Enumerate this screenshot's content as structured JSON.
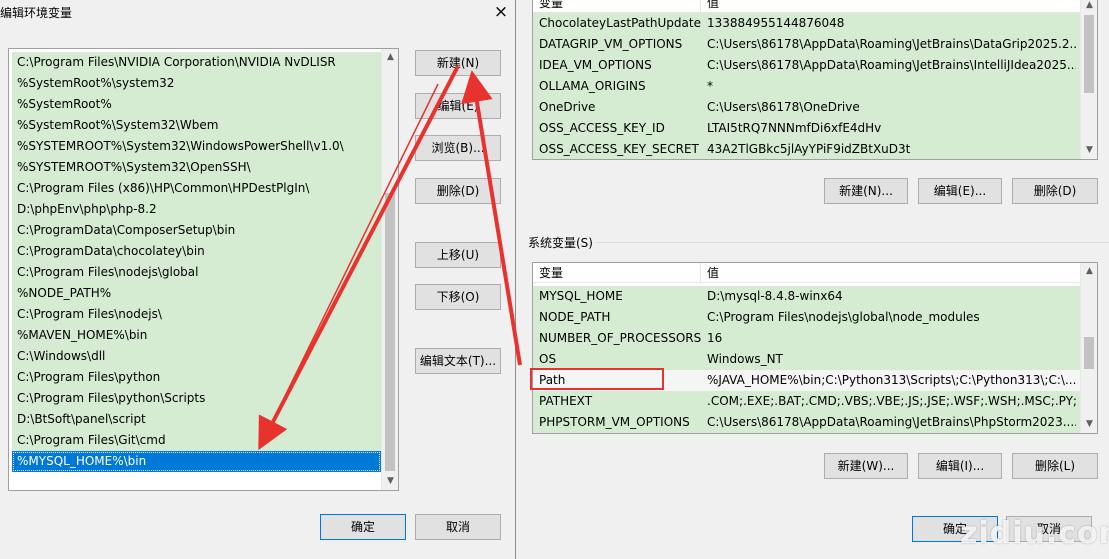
{
  "dialog": {
    "title": "编辑环境变量",
    "close_glyph": "×",
    "path_items": [
      "C:\\Program Files\\NVIDIA Corporation\\NVIDIA NvDLISR",
      "%SystemRoot%\\system32",
      "%SystemRoot%",
      "%SystemRoot%\\System32\\Wbem",
      "%SYSTEMROOT%\\System32\\WindowsPowerShell\\v1.0\\",
      "%SYSTEMROOT%\\System32\\OpenSSH\\",
      "C:\\Program Files (x86)\\HP\\Common\\HPDestPlgIn\\",
      "D:\\phpEnv\\php\\php-8.2",
      "C:\\ProgramData\\ComposerSetup\\bin",
      "C:\\ProgramData\\chocolatey\\bin",
      "C:\\Program Files\\nodejs\\global",
      "%NODE_PATH%",
      "C:\\Program Files\\nodejs\\",
      "%MAVEN_HOME%\\bin",
      "C:\\Windows\\dll",
      "C:\\Program Files\\python",
      "C:\\Program Files\\python\\Scripts",
      "D:\\BtSoft\\panel\\script",
      "C:\\Program Files\\Git\\cmd",
      "%MYSQL_HOME%\\bin"
    ],
    "selected_index": 19,
    "buttons": {
      "new": "新建(N)",
      "edit": "编辑(E)",
      "browse": "浏览(B)...",
      "delete": "删除(D)",
      "move_up": "上移(U)",
      "move_down": "下移(O)",
      "edit_text": "编辑文本(T)...",
      "ok": "确定",
      "cancel": "取消"
    }
  },
  "user_vars": {
    "header": {
      "name": "变量",
      "value": "值"
    },
    "rows": [
      {
        "name": "ChocolateyLastPathUpdate",
        "value": "133884955144876048"
      },
      {
        "name": "DATAGRIP_VM_OPTIONS",
        "value": "C:\\Users\\86178\\AppData\\Roaming\\JetBrains\\DataGrip2025.2..."
      },
      {
        "name": "IDEA_VM_OPTIONS",
        "value": "C:\\Users\\86178\\AppData\\Roaming\\JetBrains\\IntelliJIdea2025...."
      },
      {
        "name": "OLLAMA_ORIGINS",
        "value": "*"
      },
      {
        "name": "OneDrive",
        "value": "C:\\Users\\86178\\OneDrive"
      },
      {
        "name": "OSS_ACCESS_KEY_ID",
        "value": "LTAI5tRQ7NNNmfDi6xfE4dHv"
      },
      {
        "name": "OSS_ACCESS_KEY_SECRET",
        "value": "43A2TlGBkc5jlAyYPiF9idZBtXuD3t"
      }
    ],
    "buttons": {
      "new": "新建(N)...",
      "edit": "编辑(E)...",
      "delete": "删除(D)"
    }
  },
  "system_vars": {
    "section_label": "系统变量(S)",
    "header": {
      "name": "变量",
      "value": "值"
    },
    "rows": [
      {
        "name": "MYSQL_HOME",
        "value": "D:\\mysql-8.4.8-winx64"
      },
      {
        "name": "NODE_PATH",
        "value": "C:\\Program Files\\nodejs\\global\\node_modules"
      },
      {
        "name": "NUMBER_OF_PROCESSORS",
        "value": "16"
      },
      {
        "name": "OS",
        "value": "Windows_NT"
      },
      {
        "name": "Path",
        "value": "%JAVA_HOME%\\bin;C:\\Python313\\Scripts\\;C:\\Python313\\;C:\\..."
      },
      {
        "name": "PATHEXT",
        "value": ".COM;.EXE;.BAT;.CMD;.VBS;.VBE;.JS;.JSE;.WSF;.WSH;.MSC;.PY;.P..."
      },
      {
        "name": "PHPSTORM_VM_OPTIONS",
        "value": "C:\\Users\\86178\\AppData\\Roaming\\JetBrains\\PhpStorm2023...."
      }
    ],
    "highlighted_row": 4,
    "buttons": {
      "new": "新建(W)...",
      "edit": "编辑(I)...",
      "delete": "删除(L)"
    }
  },
  "env_dialog_buttons": {
    "ok": "确定",
    "cancel": "取消"
  },
  "watermark": "zidiu.com",
  "colors": {
    "row_green": "#d5ecd2",
    "selection_blue": "#0078d7",
    "annotation_red": "#e8322d"
  }
}
